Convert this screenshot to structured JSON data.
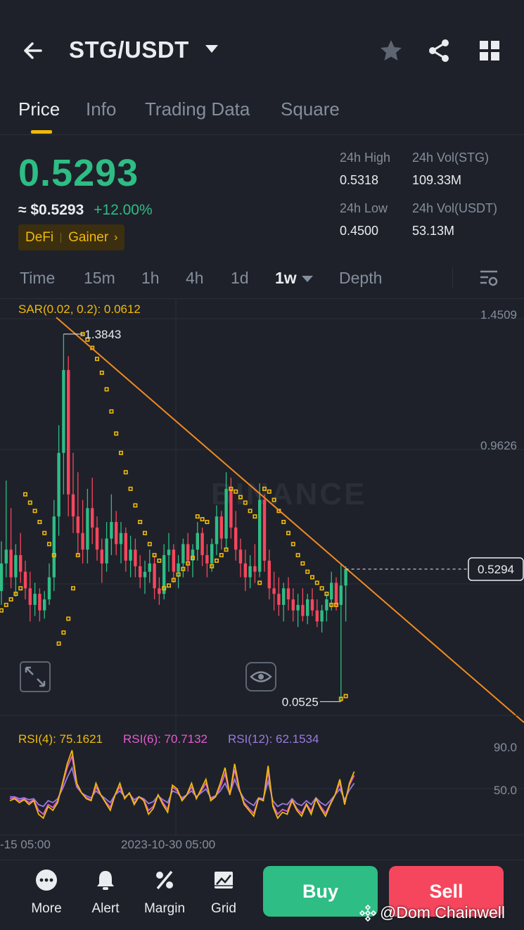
{
  "header": {
    "pair": "STG/USDT",
    "icons": [
      "back-arrow-icon",
      "caret-down-icon",
      "star-icon",
      "share-icon",
      "grid-icon"
    ]
  },
  "tabs": [
    "Price",
    "Info",
    "Trading Data",
    "Square"
  ],
  "active_tab": "Price",
  "ticker": {
    "last_price": "0.5293",
    "usd_price": "≈ $0.5293",
    "change_pct": "+12.00%",
    "tag_category": "DeFi",
    "tag_rank": "Gainer",
    "stats": {
      "high_label": "24h High",
      "high_value": "0.5318",
      "low_label": "24h Low",
      "low_value": "0.4500",
      "vol_base_label": "24h Vol(STG)",
      "vol_base_value": "109.33M",
      "vol_quote_label": "24h Vol(USDT)",
      "vol_quote_value": "53.13M"
    }
  },
  "intervals": [
    "Time",
    "15m",
    "1h",
    "4h",
    "1d",
    "1w",
    "Depth"
  ],
  "active_interval": "1w",
  "colors": {
    "up": "#2ebd85",
    "down": "#f6465d",
    "accent": "#f0b90b",
    "bg": "#1e2129",
    "rsi4": "#f0b90b",
    "rsi6": "#e45bd0",
    "rsi12": "#9a7be0",
    "trendline": "#f08a24"
  },
  "chart_data": {
    "type": "candlestick",
    "indicator_label": "SAR(0.02, 0.2): 0.0612",
    "price_axis": [
      "1.4509",
      "0.9626"
    ],
    "ylim": [
      0.0,
      1.4509
    ],
    "last_price_tag": "0.5294",
    "high_annotation": "1.3843",
    "low_annotation": "0.0525",
    "watermark": "BINANCE",
    "time_labels": [
      "-15 05:00",
      "2023-10-30 05:00"
    ],
    "candles": [
      [
        0.45,
        0.63,
        0.4,
        0.55
      ],
      [
        0.55,
        0.85,
        0.5,
        0.6
      ],
      [
        0.6,
        0.75,
        0.46,
        0.5
      ],
      [
        0.5,
        0.62,
        0.43,
        0.58
      ],
      [
        0.58,
        0.66,
        0.48,
        0.52
      ],
      [
        0.52,
        0.56,
        0.42,
        0.46
      ],
      [
        0.46,
        0.52,
        0.34,
        0.4
      ],
      [
        0.4,
        0.48,
        0.36,
        0.44
      ],
      [
        0.44,
        0.46,
        0.34,
        0.38
      ],
      [
        0.38,
        0.45,
        0.35,
        0.42
      ],
      [
        0.42,
        0.55,
        0.4,
        0.5
      ],
      [
        0.5,
        0.78,
        0.45,
        0.72
      ],
      [
        0.72,
        1.05,
        0.65,
        0.95
      ],
      [
        0.95,
        1.38,
        0.8,
        1.25
      ],
      [
        1.25,
        1.3,
        0.72,
        0.8
      ],
      [
        0.8,
        0.95,
        0.66,
        0.72
      ],
      [
        0.72,
        0.88,
        0.58,
        0.66
      ],
      [
        0.66,
        0.78,
        0.55,
        0.6
      ],
      [
        0.6,
        0.82,
        0.55,
        0.75
      ],
      [
        0.75,
        0.86,
        0.62,
        0.68
      ],
      [
        0.68,
        0.72,
        0.56,
        0.6
      ],
      [
        0.6,
        0.64,
        0.48,
        0.55
      ],
      [
        0.55,
        0.7,
        0.52,
        0.64
      ],
      [
        0.64,
        0.8,
        0.58,
        0.7
      ],
      [
        0.7,
        0.74,
        0.58,
        0.62
      ],
      [
        0.62,
        0.7,
        0.55,
        0.66
      ],
      [
        0.66,
        0.68,
        0.52,
        0.56
      ],
      [
        0.56,
        0.65,
        0.5,
        0.6
      ],
      [
        0.6,
        0.64,
        0.5,
        0.54
      ],
      [
        0.54,
        0.58,
        0.46,
        0.5
      ],
      [
        0.5,
        0.56,
        0.44,
        0.52
      ],
      [
        0.52,
        0.6,
        0.48,
        0.55
      ],
      [
        0.55,
        0.58,
        0.42,
        0.46
      ],
      [
        0.46,
        0.5,
        0.4,
        0.44
      ],
      [
        0.44,
        0.62,
        0.42,
        0.58
      ],
      [
        0.58,
        0.66,
        0.52,
        0.6
      ],
      [
        0.6,
        0.62,
        0.48,
        0.52
      ],
      [
        0.52,
        0.58,
        0.46,
        0.55
      ],
      [
        0.55,
        0.64,
        0.5,
        0.62
      ],
      [
        0.62,
        0.66,
        0.52,
        0.56
      ],
      [
        0.56,
        0.62,
        0.5,
        0.6
      ],
      [
        0.6,
        0.7,
        0.56,
        0.66
      ],
      [
        0.66,
        0.68,
        0.54,
        0.58
      ],
      [
        0.58,
        0.62,
        0.5,
        0.55
      ],
      [
        0.55,
        0.64,
        0.52,
        0.62
      ],
      [
        0.62,
        0.76,
        0.58,
        0.72
      ],
      [
        0.72,
        0.74,
        0.6,
        0.64
      ],
      [
        0.64,
        0.88,
        0.6,
        0.82
      ],
      [
        0.82,
        0.86,
        0.64,
        0.68
      ],
      [
        0.68,
        0.74,
        0.56,
        0.6
      ],
      [
        0.6,
        0.64,
        0.5,
        0.55
      ],
      [
        0.55,
        0.6,
        0.45,
        0.5
      ],
      [
        0.5,
        0.58,
        0.46,
        0.54
      ],
      [
        0.54,
        0.62,
        0.48,
        0.52
      ],
      [
        0.52,
        0.84,
        0.5,
        0.78
      ],
      [
        0.78,
        0.8,
        0.52,
        0.56
      ],
      [
        0.56,
        0.6,
        0.42,
        0.46
      ],
      [
        0.46,
        0.52,
        0.38,
        0.44
      ],
      [
        0.44,
        0.5,
        0.36,
        0.4
      ],
      [
        0.4,
        0.48,
        0.34,
        0.46
      ],
      [
        0.46,
        0.5,
        0.38,
        0.42
      ],
      [
        0.42,
        0.46,
        0.34,
        0.38
      ],
      [
        0.38,
        0.44,
        0.32,
        0.4
      ],
      [
        0.4,
        0.46,
        0.34,
        0.36
      ],
      [
        0.36,
        0.44,
        0.33,
        0.42
      ],
      [
        0.42,
        0.46,
        0.36,
        0.38
      ],
      [
        0.38,
        0.42,
        0.32,
        0.34
      ],
      [
        0.34,
        0.4,
        0.3,
        0.38
      ],
      [
        0.38,
        0.44,
        0.34,
        0.42
      ],
      [
        0.42,
        0.52,
        0.38,
        0.48
      ],
      [
        0.48,
        0.5,
        0.38,
        0.4
      ],
      [
        0.4,
        0.55,
        0.05,
        0.47
      ],
      [
        0.47,
        0.54,
        0.34,
        0.53
      ]
    ],
    "sar": [
      0.38,
      0.4,
      0.42,
      0.44,
      0.46,
      0.8,
      0.77,
      0.74,
      0.7,
      0.66,
      0.62,
      0.58,
      0.26,
      0.3,
      0.35,
      0.46,
      0.58,
      1.38,
      1.36,
      1.33,
      1.29,
      1.24,
      1.18,
      1.1,
      1.02,
      0.95,
      0.88,
      0.82,
      0.76,
      0.7,
      0.66,
      0.62,
      0.58,
      0.56,
      0.46,
      0.47,
      0.49,
      0.51,
      0.53,
      0.55,
      0.57,
      0.72,
      0.71,
      0.7,
      0.54,
      0.56,
      0.58,
      0.6,
      0.82,
      0.81,
      0.79,
      0.77,
      0.74,
      0.72,
      0.48,
      0.82,
      0.81,
      0.78,
      0.74,
      0.7,
      0.66,
      0.62,
      0.58,
      0.55,
      0.52,
      0.5,
      0.48,
      0.46,
      0.44,
      0.4,
      0.4,
      0.06,
      0.07
    ],
    "trendline": {
      "from": [
        0.16,
        1.44
      ],
      "to": [
        1.0,
        0.0
      ]
    },
    "rsi": {
      "labels": [
        "RSI(4): 75.1621",
        "RSI(6): 70.7132",
        "RSI(12): 62.1534"
      ],
      "axis": [
        "90.0",
        "50.0"
      ],
      "ylim": [
        10,
        100
      ],
      "rsi4": [
        44,
        46,
        42,
        45,
        40,
        44,
        30,
        26,
        38,
        34,
        42,
        62,
        82,
        96,
        62,
        52,
        46,
        44,
        62,
        50,
        42,
        34,
        50,
        62,
        46,
        52,
        40,
        48,
        44,
        30,
        36,
        50,
        40,
        32,
        60,
        56,
        44,
        50,
        62,
        46,
        56,
        66,
        44,
        48,
        62,
        78,
        50,
        82,
        56,
        40,
        34,
        28,
        46,
        44,
        80,
        38,
        26,
        32,
        30,
        44,
        34,
        28,
        40,
        30,
        46,
        36,
        28,
        40,
        50,
        66,
        40,
        62,
        74
      ],
      "rsi6": [
        46,
        47,
        44,
        46,
        42,
        45,
        34,
        30,
        40,
        37,
        44,
        60,
        78,
        90,
        60,
        52,
        47,
        45,
        58,
        50,
        43,
        37,
        50,
        58,
        47,
        52,
        42,
        48,
        45,
        34,
        38,
        50,
        42,
        35,
        58,
        54,
        45,
        50,
        58,
        47,
        54,
        62,
        46,
        48,
        58,
        72,
        50,
        76,
        55,
        42,
        36,
        31,
        46,
        45,
        74,
        40,
        30,
        35,
        33,
        45,
        36,
        31,
        41,
        33,
        46,
        38,
        31,
        41,
        50,
        62,
        42,
        60,
        70
      ],
      "rsi12": [
        48,
        48,
        46,
        47,
        45,
        46,
        40,
        38,
        44,
        42,
        46,
        56,
        68,
        78,
        58,
        52,
        49,
        47,
        54,
        50,
        46,
        42,
        50,
        54,
        48,
        51,
        45,
        48,
        46,
        41,
        43,
        49,
        45,
        42,
        54,
        52,
        47,
        50,
        54,
        48,
        52,
        56,
        47,
        49,
        54,
        62,
        51,
        66,
        54,
        46,
        42,
        39,
        47,
        46,
        64,
        44,
        38,
        41,
        40,
        46,
        41,
        39,
        44,
        40,
        47,
        42,
        39,
        44,
        50,
        56,
        45,
        55,
        62
      ]
    }
  },
  "bottom_nav": [
    {
      "label": "More",
      "icon": "more-dots-icon"
    },
    {
      "label": "Alert",
      "icon": "bell-icon"
    },
    {
      "label": "Margin",
      "icon": "percent-icon"
    },
    {
      "label": "Grid",
      "icon": "grid-bot-icon"
    }
  ],
  "actions": {
    "buy": "Buy",
    "sell": "Sell"
  },
  "overlay_author": "@Dom Chainwell"
}
